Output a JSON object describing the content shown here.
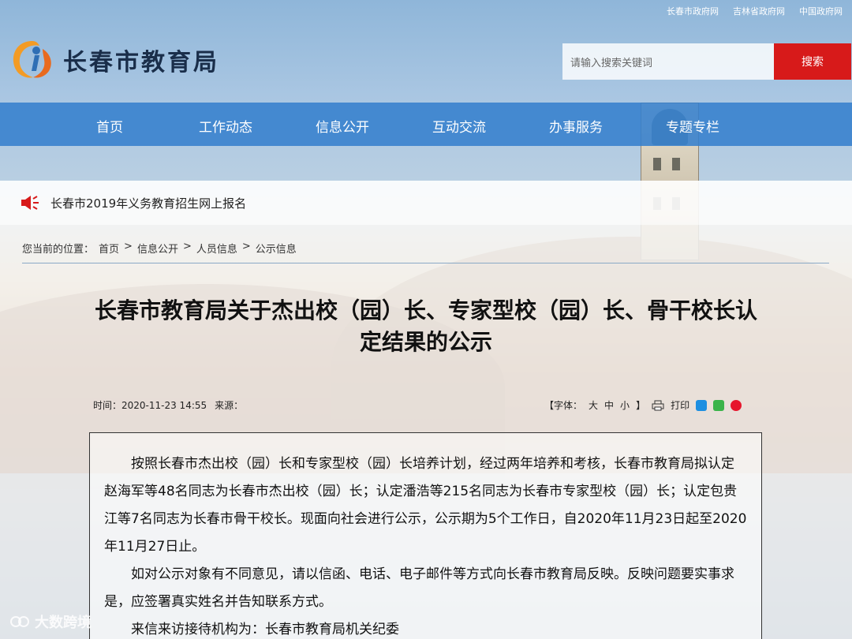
{
  "top_links": [
    "长春市政府网",
    "吉林省政府网",
    "中国政府网"
  ],
  "site": {
    "name": "长春市教育局"
  },
  "search": {
    "placeholder": "请输入搜索关键词",
    "button": "搜索"
  },
  "nav": [
    "首页",
    "工作动态",
    "信息公开",
    "互动交流",
    "办事服务",
    "专题专栏"
  ],
  "notice": {
    "text": "长春市2019年义务教育招生网上报名"
  },
  "breadcrumb": {
    "label": "您当前的位置：",
    "items": [
      "首页",
      "信息公开",
      "人员信息",
      "公示信息"
    ],
    "separator": ">"
  },
  "article": {
    "title": "长春市教育局关于杰出校（园）长、专家型校（园）长、骨干校长认定结果的公示",
    "time_label": "时间：2020-11-23 14:55",
    "source_label": "来源：",
    "font_label": "【字体：",
    "font_large": "大",
    "font_medium": "中",
    "font_small": "小",
    "font_close": "】",
    "print_label": "打印",
    "paragraphs": [
      "按照长春市杰出校（园）长和专家型校（园）长培养计划，经过两年培养和考核，长春市教育局拟认定赵海军等48名同志为长春市杰出校（园）长；认定潘浩等215名同志为长春市专家型校（园）长；认定包贵江等7名同志为长春市骨干校长。现面向社会进行公示，公示期为5个工作日，自2020年11月23日起至2020年11月27日止。",
      "如对公示对象有不同意见，请以信函、电话、电子邮件等方式向长春市教育局反映。反映问题要实事求是，应签署真实姓名并告知联系方式。",
      "来信来访接待机构为：长春市教育局机关纪委"
    ]
  },
  "watermark": {
    "text": "大数跨境"
  },
  "colors": {
    "nav_bg": "#3680cd",
    "search_btn": "#d71a1a",
    "notice_icon": "#d71a1a"
  }
}
